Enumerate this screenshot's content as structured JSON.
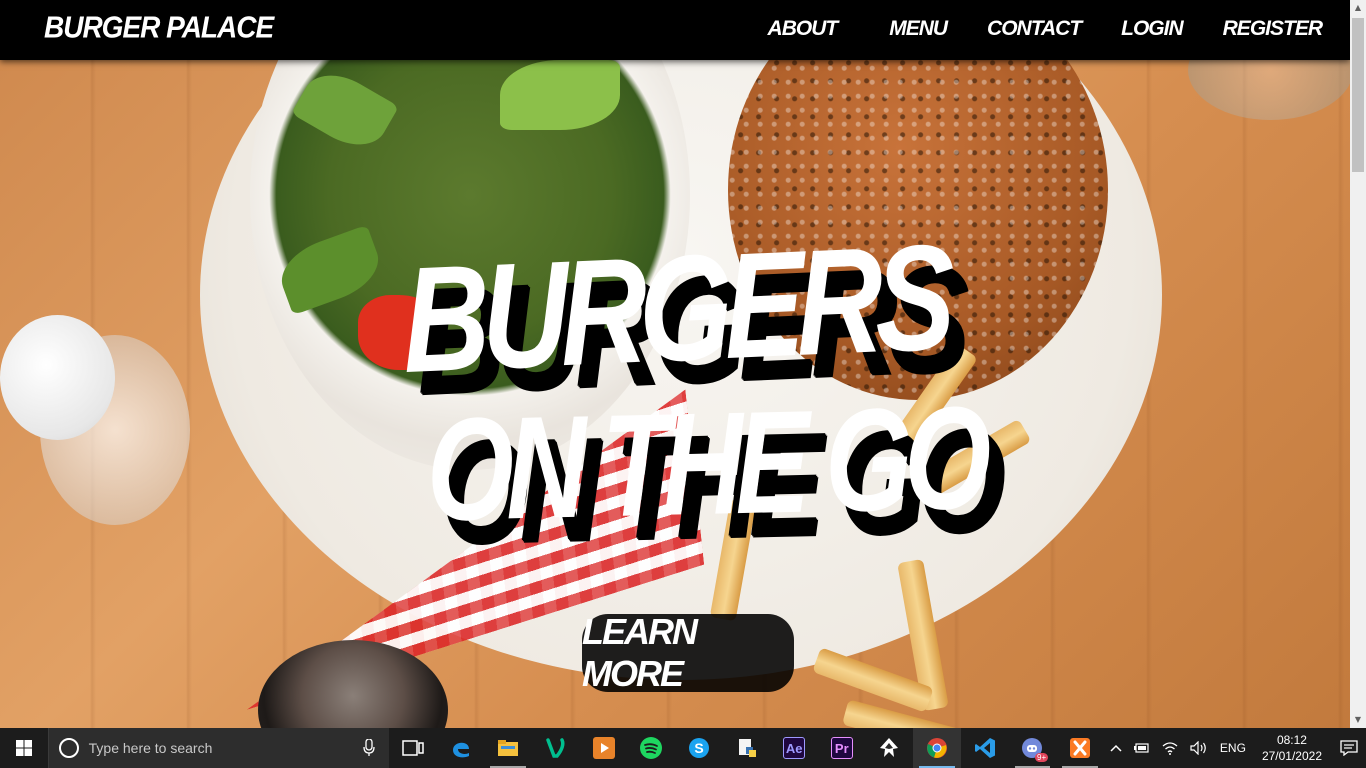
{
  "navbar": {
    "brand": "BURGER PALACE",
    "links": [
      "ABOUT",
      "MENU",
      "CONTACT",
      "LOGIN",
      "REGISTER"
    ]
  },
  "hero": {
    "headline_line1": "BURGERS",
    "headline_line2": "ON THE GO",
    "cta_label": "LEARN MORE"
  },
  "taskbar": {
    "search_placeholder": "Type here to search",
    "apps": [
      "task-view-icon",
      "edge-icon",
      "file-explorer-icon",
      "vine-icon",
      "media-player-icon",
      "spotify-icon",
      "skype-icon",
      "python-idle-icon",
      "after-effects-icon",
      "premiere-pro-icon",
      "inkscape-icon",
      "chrome-icon",
      "vscode-icon",
      "discord-icon",
      "xampp-icon"
    ],
    "ae_label": "Ae",
    "pr_label": "Pr",
    "discord_badge": "9+",
    "language": "ENG",
    "time": "08:12",
    "date": "27/01/2022"
  },
  "colors": {
    "nav_bg": "#000000",
    "hero_text": "#ffffff",
    "button_bg": "#000000",
    "taskbar_bg": "#1c1c1c",
    "accent": "#76b9ed"
  }
}
